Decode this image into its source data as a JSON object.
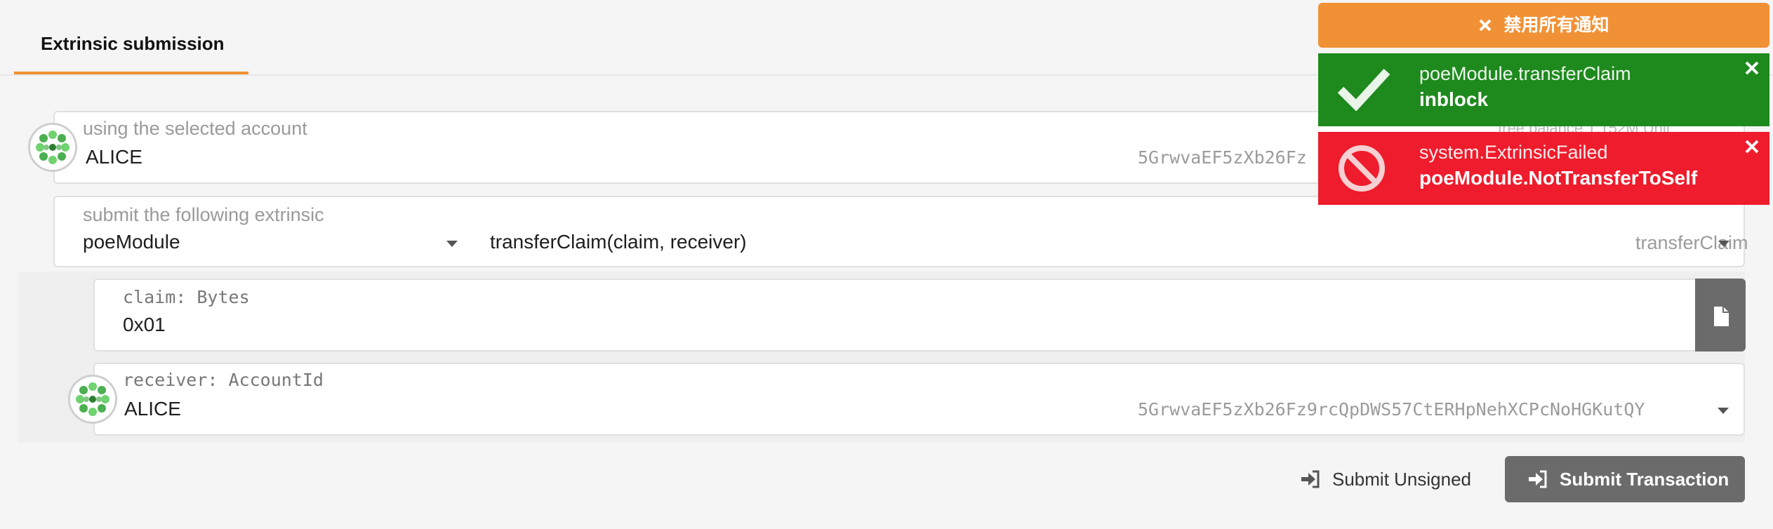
{
  "tabs": [
    {
      "label": "Extrinsic submission",
      "active": true
    }
  ],
  "account": {
    "label": "using the selected account",
    "name": "ALICE",
    "address": "5GrwvaEF5zXb26Fz9rcQpDWS57CtERHpNehXCPcNoHGKutQY",
    "address_visible": "5GrwvaEF5zXb26Fz",
    "balance_partial": "free balance 1.152M Unit"
  },
  "extrinsic": {
    "label": "submit the following extrinsic",
    "module": "poeModule",
    "call_signature": "transferClaim(claim, receiver)",
    "call": "transferClaim"
  },
  "params": {
    "claim": {
      "label": "claim: Bytes",
      "value": "0x01"
    },
    "receiver": {
      "label": "receiver: AccountId",
      "name": "ALICE",
      "address": "5GrwvaEF5zXb26Fz9rcQpDWS57CtERHpNehXCPcNoHGKutQY"
    }
  },
  "actions": {
    "submit_unsigned": "Submit Unsigned",
    "submit_transaction": "Submit Transaction"
  },
  "notifications": {
    "dismiss_all": "禁用所有通知",
    "items": [
      {
        "title": "poeModule.transferClaim",
        "status": "inblock",
        "color": "#1e8a1e",
        "icon": "check-icon"
      },
      {
        "title": "system.ExtrinsicFailed",
        "status": "poeModule.NotTransferToSelf",
        "color": "#ee1c2c",
        "icon": "ban-icon"
      }
    ]
  },
  "colors": {
    "accent": "#f19135",
    "button": "#6b6b6b",
    "success": "#1e8a1e",
    "error": "#ee1c2c"
  }
}
